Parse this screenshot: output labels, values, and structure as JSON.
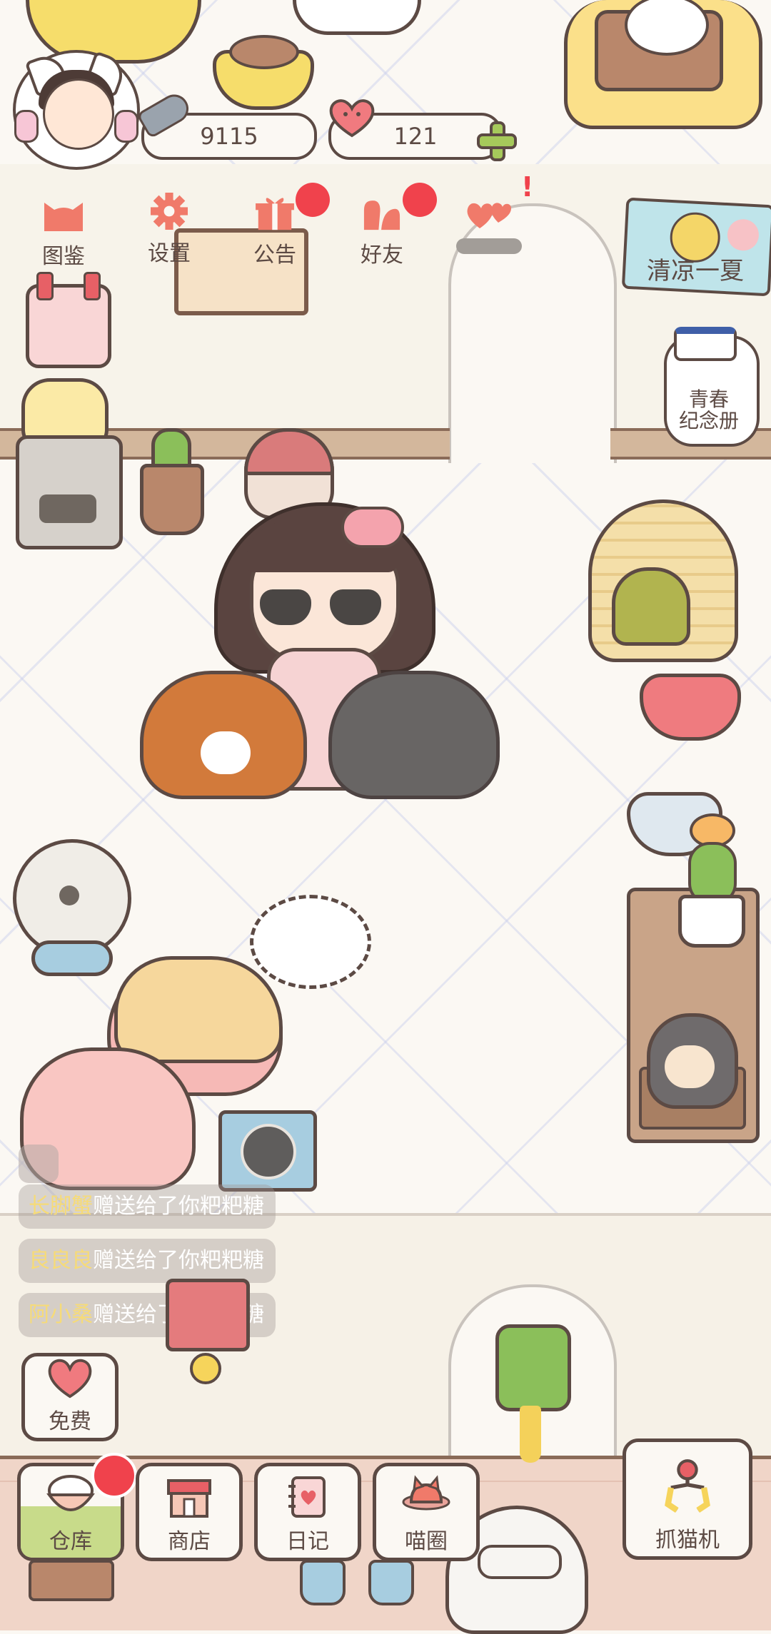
{
  "hud": {
    "fish_currency": "9115",
    "heart_currency": "121"
  },
  "top_menu": {
    "items": [
      {
        "label": "图鉴",
        "icon": "cat-head-icon",
        "badge": false
      },
      {
        "label": "设置",
        "icon": "gear-icon",
        "badge": false
      },
      {
        "label": "公告",
        "icon": "gift-icon",
        "badge": true
      },
      {
        "label": "好友",
        "icon": "friends-icon",
        "badge": true
      },
      {
        "label": "",
        "icon": "hearts-icon",
        "badge": false,
        "alert": "!"
      }
    ]
  },
  "side": {
    "event_label": "清凉一夏",
    "youth_album_line1": "青春",
    "youth_album_line2": "纪念册"
  },
  "chat_log": [
    {
      "name": "长脚蟹",
      "text": "赠送给了你粑粑糖"
    },
    {
      "name": "良良良",
      "text": "赠送给了你粑粑糖"
    },
    {
      "name": "阿小桑",
      "text": "赠送给了你粑粑糖"
    }
  ],
  "free_button": {
    "label": "免费",
    "icon": "heart-icon"
  },
  "bottom_nav": [
    {
      "label": "仓库",
      "icon": "rice-bowl-icon",
      "badge": true
    },
    {
      "label": "商店",
      "icon": "shop-icon",
      "badge": false
    },
    {
      "label": "日记",
      "icon": "diary-icon",
      "badge": false
    },
    {
      "label": "喵圈",
      "icon": "cat-planet-icon",
      "badge": false
    }
  ],
  "claw_machine": {
    "label": "抓猫机",
    "icon": "claw-icon"
  },
  "colors": {
    "outline": "#5c4a44",
    "badge_red": "#f0424c",
    "accent_pink": "#f07a6a",
    "chat_name": "#f6db78",
    "plus_green": "#a6c95b"
  }
}
